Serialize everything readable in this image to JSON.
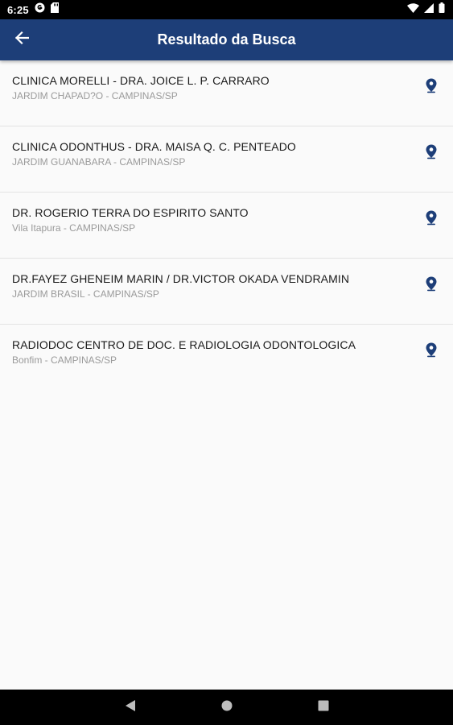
{
  "status_bar": {
    "time": "6:25",
    "icons": [
      "g-circle-icon",
      "sd-card-icon",
      "wifi-icon",
      "signal-icon",
      "battery-icon"
    ]
  },
  "app_bar": {
    "title": "Resultado da Busca",
    "back_icon": "arrow-back-icon",
    "color": "#1d3e78"
  },
  "results": [
    {
      "name": "CLINICA MORELLI - DRA. JOICE L. P. CARRARO",
      "location": "JARDIM CHAPAD?O - CAMPINAS/SP",
      "icon": "map-pin-icon"
    },
    {
      "name": "CLINICA ODONTHUS - DRA. MAISA Q. C. PENTEADO",
      "location": "JARDIM GUANABARA - CAMPINAS/SP",
      "icon": "map-pin-icon"
    },
    {
      "name": "DR. ROGERIO TERRA DO ESPIRITO SANTO",
      "location": "Vila Itapura - CAMPINAS/SP",
      "icon": "map-pin-icon"
    },
    {
      "name": "DR.FAYEZ GHENEIM MARIN / DR.VICTOR OKADA VENDRAMIN",
      "location": "JARDIM BRASIL - CAMPINAS/SP",
      "icon": "map-pin-icon"
    },
    {
      "name": "RADIODOC CENTRO DE DOC. E RADIOLOGIA ODONTOLOGICA",
      "location": "Bonfim - CAMPINAS/SP",
      "icon": "map-pin-icon"
    }
  ],
  "nav_bar": {
    "icons": [
      "back-triangle-icon",
      "home-circle-icon",
      "recents-square-icon"
    ]
  }
}
